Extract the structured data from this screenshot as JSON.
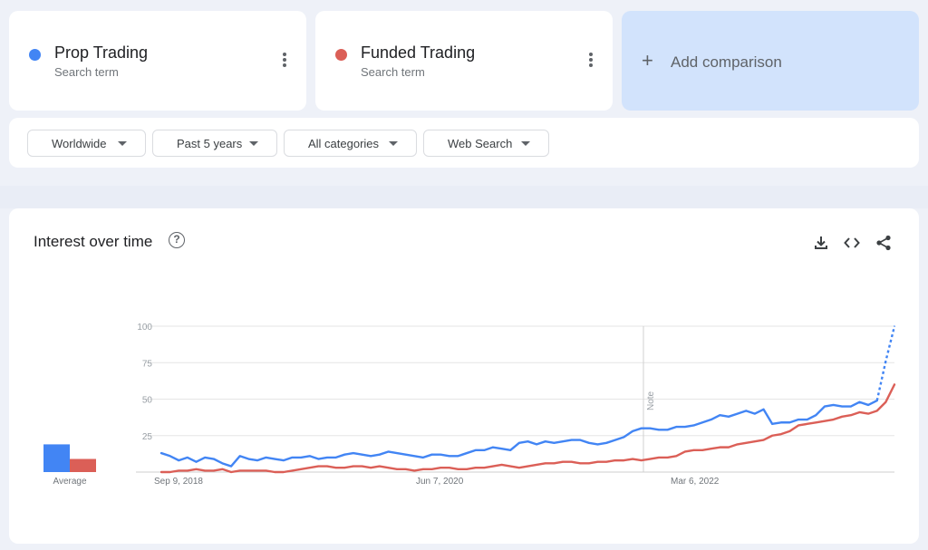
{
  "terms": [
    {
      "name": "Prop Trading",
      "sub": "Search term",
      "color": "#4285f4"
    },
    {
      "name": "Funded Trading",
      "sub": "Search term",
      "color": "#db5f57"
    }
  ],
  "add_comparison": {
    "icon": "plus-icon",
    "label": "Add comparison"
  },
  "filters": {
    "geo": "Worldwide",
    "time": "Past 5 years",
    "category": "All categories",
    "search_type": "Web Search"
  },
  "chart": {
    "title": "Interest over time",
    "help_icon": "help-icon",
    "tools": [
      "download-icon",
      "embed-icon",
      "share-icon"
    ],
    "note_label": "Note",
    "average_label": "Average"
  },
  "chart_data": {
    "type": "line",
    "ylim": [
      0,
      100
    ],
    "yticks": [
      "100",
      "75",
      "50",
      "25"
    ],
    "x_tick_labels": [
      "Sep 9, 2018",
      "Jun 7, 2020",
      "Mar 6, 2022"
    ],
    "grid": true,
    "note_at": "Jan 2022",
    "series": [
      {
        "name": "Prop Trading",
        "color": "#4285f4",
        "average": 19,
        "values": [
          13,
          11,
          8,
          10,
          7,
          10,
          9,
          6,
          4,
          11,
          9,
          8,
          10,
          9,
          8,
          10,
          10,
          11,
          9,
          10,
          10,
          12,
          13,
          12,
          11,
          12,
          14,
          13,
          12,
          11,
          10,
          12,
          12,
          11,
          11,
          13,
          15,
          15,
          17,
          16,
          15,
          20,
          21,
          19,
          21,
          20,
          21,
          22,
          22,
          20,
          19,
          20,
          22,
          24,
          28,
          30,
          30,
          29,
          29,
          31,
          31,
          32,
          34,
          36,
          39,
          38,
          40,
          42,
          40,
          43,
          33,
          34,
          34,
          36,
          36,
          39,
          45,
          46,
          45,
          45,
          48,
          46,
          49,
          76,
          100
        ],
        "dashed_from_index": 82
      },
      {
        "name": "Funded Trading",
        "color": "#db5f57",
        "average": 9,
        "values": [
          0,
          0,
          1,
          1,
          2,
          1,
          1,
          2,
          0,
          1,
          1,
          1,
          1,
          0,
          0,
          1,
          2,
          3,
          4,
          4,
          3,
          3,
          4,
          4,
          3,
          4,
          3,
          2,
          2,
          1,
          2,
          2,
          3,
          3,
          2,
          2,
          3,
          3,
          4,
          5,
          4,
          3,
          4,
          5,
          6,
          6,
          7,
          7,
          6,
          6,
          7,
          7,
          8,
          8,
          9,
          8,
          9,
          10,
          10,
          11,
          14,
          15,
          15,
          16,
          17,
          17,
          19,
          20,
          21,
          22,
          25,
          26,
          28,
          32,
          33,
          34,
          35,
          36,
          38,
          39,
          41,
          40,
          42,
          48,
          60
        ]
      }
    ]
  }
}
